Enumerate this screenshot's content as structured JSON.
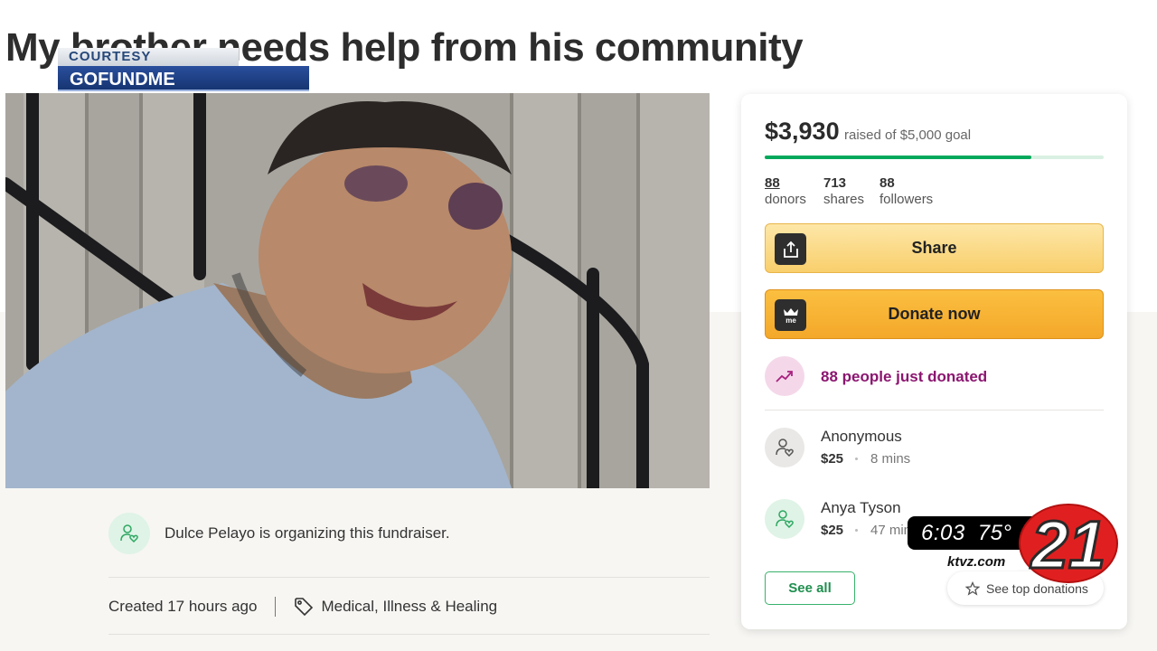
{
  "page": {
    "title": "My brother needs help from his community"
  },
  "overlay": {
    "courtesy": "COURTESY",
    "source": "GOFUNDME",
    "clock": "6:03",
    "temperature": "75°",
    "site": "ktvz.com",
    "logo_number": "21"
  },
  "organizer": {
    "text": "Dulce Pelayo is organizing this fundraiser.",
    "created": "Created 17 hours ago",
    "category": "Medical, Illness & Healing"
  },
  "donation_card": {
    "raised": "$3,930",
    "goal_text": "raised of $5,000 goal",
    "progress_fraction": 0.786,
    "stats": [
      {
        "number": "88",
        "label": "donors"
      },
      {
        "number": "713",
        "label": "shares"
      },
      {
        "number": "88",
        "label": "followers"
      }
    ],
    "share_label": "Share",
    "donate_label": "Donate now",
    "recent_text": "88 people just donated",
    "donations": [
      {
        "name": "Anonymous",
        "amount": "$25",
        "time": "8 mins"
      },
      {
        "name": "Anya Tyson",
        "amount": "$25",
        "time": "47 mins"
      }
    ],
    "see_all_label": "See all",
    "see_top_label": "See top donations"
  },
  "colors": {
    "brand_green": "#02a95c",
    "donate_orange": "#f4a82a",
    "recent_purple": "#8b1670",
    "news_red": "#e02020"
  }
}
